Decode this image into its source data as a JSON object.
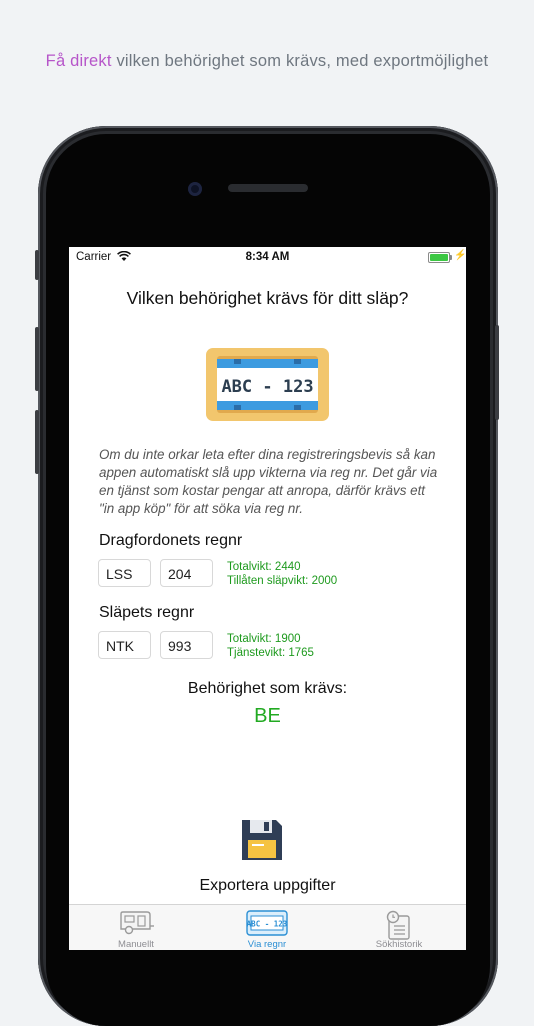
{
  "caption": {
    "highlight": "Få direkt",
    "rest": " vilken behörighet som krävs, med exportmöjlighet"
  },
  "status_bar": {
    "carrier": "Carrier",
    "time": "8:34 AM"
  },
  "screen": {
    "title": "Vilken behörighet krävs för ditt släp?",
    "plate_text": "ABC - 123",
    "info_text": "Om du inte orkar leta efter dina registreringsbevis så kan appen automatiskt slå upp vikterna via reg nr. Det går via en tjänst som kostar pengar att anropa, därför krävs ett \"in app köp\" för att söka via reg nr.",
    "tow_vehicle": {
      "label": "Dragfordonets regnr",
      "letters": "LSS",
      "digits": "204",
      "total_weight": "Totalvikt: 2440",
      "allowed_trailer": "Tillåten släpvikt: 2000"
    },
    "trailer": {
      "label": "Släpets regnr",
      "letters": "NTK",
      "digits": "993",
      "total_weight": "Totalvikt: 1900",
      "curb_weight": "Tjänstevikt: 1765"
    },
    "requirement_label": "Behörighet som krävs:",
    "requirement_value": "BE",
    "export_label": "Exportera uppgifter"
  },
  "tabs": [
    {
      "label": "Manuellt",
      "icon": "trailer-icon",
      "active": false
    },
    {
      "label": "Via regnr",
      "icon": "license-plate-icon",
      "active": true
    },
    {
      "label": "Sökhistorik",
      "icon": "history-document-icon",
      "active": false
    }
  ],
  "colors": {
    "accent_purple": "#b655c9",
    "green": "#22aa22",
    "tab_active": "#2b8fd4",
    "plate_frame": "#f2c66d",
    "plate_blue": "#3d9be0"
  }
}
